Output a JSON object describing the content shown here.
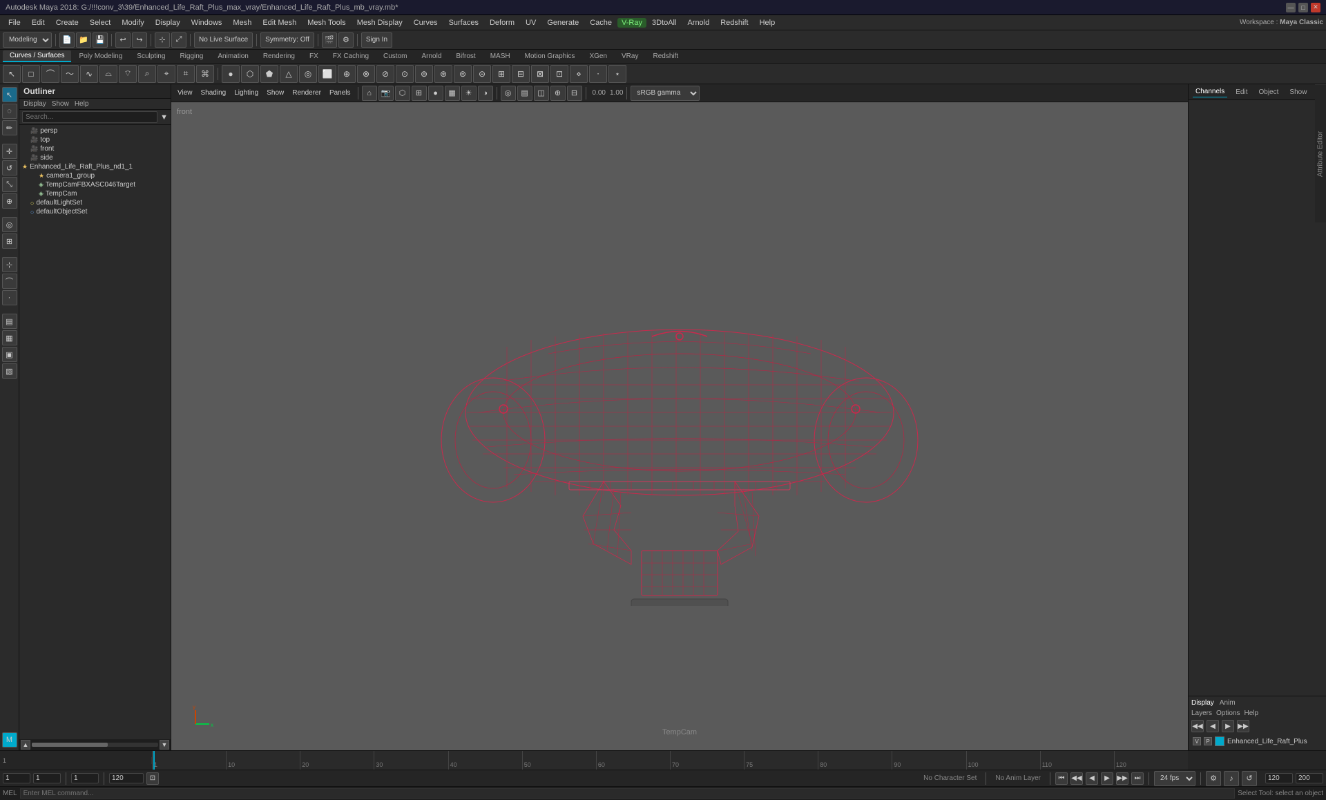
{
  "title_bar": {
    "title": "Autodesk Maya 2018: G:/!!!conv_3\\39/Enhanced_Life_Raft_Plus_max_vray/Enhanced_Life_Raft_Plus_mb_vray.mb*",
    "min": "—",
    "max": "□",
    "close": "✕"
  },
  "menu_bar": {
    "items": [
      "File",
      "Edit",
      "Create",
      "Select",
      "Modify",
      "Display",
      "Windows",
      "Mesh",
      "Edit Mesh",
      "Mesh Tools",
      "Mesh Display",
      "Curves",
      "Surfaces",
      "Deform",
      "UV",
      "Generate",
      "Cache"
    ],
    "vray": "V-Ray",
    "extra": [
      "3DtoAll",
      "Arnold",
      "Redshift",
      "Help"
    ],
    "workspace_label": "Workspace :",
    "workspace_value": "Maya Classic"
  },
  "toolbar1": {
    "mode_label": "Modeling",
    "no_live_surface": "No Live Surface",
    "symmetry_label": "Symmetry: Off",
    "sign_in": "Sign In"
  },
  "shelf_tabs": {
    "items": [
      "Curves / Surfaces",
      "Poly Modeling",
      "Sculpting",
      "Rigging",
      "Animation",
      "Rendering",
      "FX",
      "FX Caching",
      "Custom",
      "Arnold",
      "Bifrost",
      "MASH",
      "Motion Graphics",
      "XGen",
      "VRay",
      "Redshift"
    ]
  },
  "outliner": {
    "title": "Outliner",
    "menu": [
      "Display",
      "Show",
      "Help"
    ],
    "search_placeholder": "Search...",
    "items": [
      {
        "label": "persp",
        "type": "camera",
        "indent": 1
      },
      {
        "label": "top",
        "type": "camera",
        "indent": 1
      },
      {
        "label": "front",
        "type": "camera",
        "indent": 1
      },
      {
        "label": "side",
        "type": "camera",
        "indent": 1
      },
      {
        "label": "Enhanced_Life_Raft_Plus_nd1_1",
        "type": "group",
        "indent": 0
      },
      {
        "label": "camera1_group",
        "type": "group",
        "indent": 2
      },
      {
        "label": "TempCamFBXASC046Target",
        "type": "geo",
        "indent": 2
      },
      {
        "label": "TempCam",
        "type": "geo",
        "indent": 2
      },
      {
        "label": "defaultLightSet",
        "type": "light",
        "indent": 1
      },
      {
        "label": "defaultObjectSet",
        "type": "mesh",
        "indent": 1
      }
    ]
  },
  "viewport": {
    "menu": [
      "View",
      "Shading",
      "Lighting",
      "Show",
      "Renderer",
      "Panels"
    ],
    "label": "front",
    "camera": "TempCam",
    "gamma_label": "sRGB gamma",
    "gamma_value": "0.00",
    "gamma_value2": "1.00"
  },
  "right_panel": {
    "header_tabs": [
      "Channels",
      "Edit",
      "Object",
      "Show"
    ],
    "display_tab": "Display",
    "anim_tab": "Anim",
    "layer_tabs": [
      "Layers",
      "Options",
      "Help"
    ],
    "layer_nav": [
      "◀◀",
      "◀",
      "▶",
      "▶▶"
    ],
    "vis_label": "V",
    "p_label": "P",
    "layer_name": "Enhanced_Life_Raft_Plus"
  },
  "frame_controls": {
    "current_frame": "1",
    "frame_range_start": "1",
    "frame_range_end": "120",
    "frame_max": "200",
    "no_character_set": "No Character Set",
    "no_anim_layer": "No Anim Layer",
    "fps_label": "24 fps",
    "playback_btns": [
      "⏮",
      "◀◀",
      "◀",
      "▶",
      "▶▶",
      "⏭"
    ]
  },
  "timeline": {
    "ticks": [
      "1",
      "10",
      "20",
      "30",
      "40",
      "50",
      "60",
      "70",
      "75",
      "80",
      "90",
      "100",
      "110",
      "120"
    ],
    "ticks2": [
      "1",
      "10",
      "20",
      "30",
      "40",
      "50",
      "60",
      "70",
      "80",
      "90",
      "100",
      "110",
      "120"
    ]
  },
  "status_bar": {
    "cmd_label": "MEL",
    "status_text": "Select Tool: select an object"
  }
}
